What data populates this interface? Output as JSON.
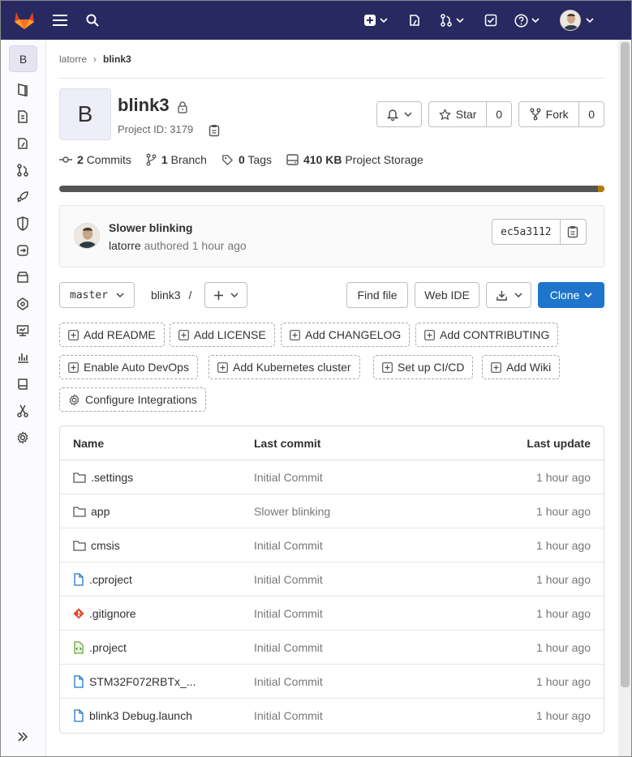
{
  "topbar": {
    "background": "#292961",
    "avatar_alt": "user-avatar"
  },
  "sidebar": {
    "project_letter": "B",
    "items": [
      "project-information",
      "repository",
      "issues",
      "merge-requests",
      "ci-cd",
      "security",
      "deployments",
      "packages",
      "infrastructure",
      "monitor",
      "analytics",
      "wiki",
      "snippets",
      "settings"
    ],
    "collapse_icon": "chevron-double-right"
  },
  "breadcrumb": {
    "parent": "latorre",
    "current": "blink3"
  },
  "project": {
    "avatar_letter": "B",
    "name": "blink3",
    "id_label": "Project ID: 3179",
    "notification_icon": "bell",
    "star_label": "Star",
    "star_count": "0",
    "fork_label": "Fork",
    "fork_count": "0"
  },
  "stats": {
    "commits_count": "2",
    "commits_label": "Commits",
    "branch_count": "1",
    "branch_label": "Branch",
    "tags_count": "0",
    "tags_label": "Tags",
    "storage_size": "410 KB",
    "storage_label": "Project Storage"
  },
  "commit": {
    "title": "Slower blinking",
    "author": "latorre",
    "authored_text": "authored",
    "time": "1 hour ago",
    "sha": "ec5a3112"
  },
  "repo_toolbar": {
    "branch": "master",
    "path": "blink3",
    "path_sep": "/",
    "find_file": "Find file",
    "web_ide": "Web IDE",
    "clone": "Clone"
  },
  "quick_actions": [
    "Add README",
    "Add LICENSE",
    "Add CHANGELOG",
    "Add CONTRIBUTING",
    "Enable Auto DevOps",
    "Add Kubernetes cluster",
    "Set up CI/CD",
    "Add Wiki",
    "Configure Integrations"
  ],
  "file_table": {
    "headers": {
      "name": "Name",
      "last_commit": "Last commit",
      "last_update": "Last update"
    },
    "rows": [
      {
        "name": ".settings",
        "type": "folder",
        "commit": "Initial Commit",
        "updated": "1 hour ago"
      },
      {
        "name": "app",
        "type": "folder",
        "commit": "Slower blinking",
        "updated": "1 hour ago"
      },
      {
        "name": "cmsis",
        "type": "folder",
        "commit": "Initial Commit",
        "updated": "1 hour ago"
      },
      {
        "name": ".cproject",
        "type": "file",
        "commit": "Initial Commit",
        "updated": "1 hour ago"
      },
      {
        "name": ".gitignore",
        "type": "git",
        "commit": "Initial Commit",
        "updated": "1 hour ago"
      },
      {
        "name": ".project",
        "type": "xml",
        "commit": "Initial Commit",
        "updated": "1 hour ago"
      },
      {
        "name": "STM32F072RBTx_...",
        "type": "file",
        "commit": "Initial Commit",
        "updated": "1 hour ago"
      },
      {
        "name": "blink3 Debug.launch",
        "type": "file",
        "commit": "Initial Commit",
        "updated": "1 hour ago"
      }
    ]
  },
  "colors": {
    "primary": "#1f75cb",
    "topbar": "#292961",
    "storage_bar": "#555555",
    "storage_tip": "#b07d00"
  }
}
